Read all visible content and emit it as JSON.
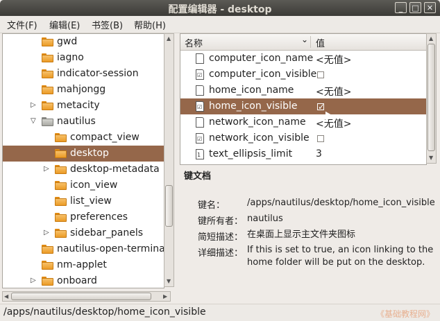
{
  "window": {
    "title": "配置编辑器 - desktop"
  },
  "window_buttons": {
    "minimize": "_",
    "maximize": "□",
    "close": "✕"
  },
  "menu": [
    "文件(F)",
    "编辑(E)",
    "书签(B)",
    "帮助(H)"
  ],
  "tree": {
    "items": [
      {
        "label": "gwd",
        "indent": 2,
        "expander": "",
        "selected": false,
        "gray": false
      },
      {
        "label": "iagno",
        "indent": 2,
        "expander": "",
        "selected": false,
        "gray": false
      },
      {
        "label": "indicator-session",
        "indent": 2,
        "expander": "",
        "selected": false,
        "gray": false
      },
      {
        "label": "mahjongg",
        "indent": 2,
        "expander": "",
        "selected": false,
        "gray": false
      },
      {
        "label": "metacity",
        "indent": 2,
        "expander": "collapsed",
        "selected": false,
        "gray": false
      },
      {
        "label": "nautilus",
        "indent": 2,
        "expander": "expanded",
        "selected": false,
        "gray": true
      },
      {
        "label": "compact_view",
        "indent": 3,
        "expander": "",
        "selected": false,
        "gray": false
      },
      {
        "label": "desktop",
        "indent": 3,
        "expander": "",
        "selected": true,
        "gray": false
      },
      {
        "label": "desktop-metadata",
        "indent": 3,
        "expander": "collapsed",
        "selected": false,
        "gray": false
      },
      {
        "label": "icon_view",
        "indent": 3,
        "expander": "",
        "selected": false,
        "gray": false
      },
      {
        "label": "list_view",
        "indent": 3,
        "expander": "",
        "selected": false,
        "gray": false
      },
      {
        "label": "preferences",
        "indent": 3,
        "expander": "",
        "selected": false,
        "gray": false
      },
      {
        "label": "sidebar_panels",
        "indent": 3,
        "expander": "collapsed",
        "selected": false,
        "gray": false
      },
      {
        "label": "nautilus-open-terminal",
        "indent": 2,
        "expander": "",
        "selected": false,
        "gray": false
      },
      {
        "label": "nm-applet",
        "indent": 2,
        "expander": "",
        "selected": false,
        "gray": false
      },
      {
        "label": "onboard",
        "indent": 2,
        "expander": "collapsed",
        "selected": false,
        "gray": false
      }
    ]
  },
  "list": {
    "headers": {
      "name": "名称",
      "value": "值"
    },
    "rows": [
      {
        "name": "computer_icon_name",
        "type": "text",
        "value": "<无值>",
        "selected": false
      },
      {
        "name": "computer_icon_visible",
        "type": "bool",
        "value": "",
        "checked": false,
        "selected": false
      },
      {
        "name": "home_icon_name",
        "type": "text",
        "value": "<无值>",
        "selected": false
      },
      {
        "name": "home_icon_visible",
        "type": "bool",
        "value": "",
        "checked": true,
        "selected": true
      },
      {
        "name": "network_icon_name",
        "type": "text",
        "value": "<无值>",
        "selected": false
      },
      {
        "name": "network_icon_visible",
        "type": "bool",
        "value": "",
        "checked": false,
        "selected": false
      },
      {
        "name": "text_ellipsis_limit",
        "type": "int",
        "value": "3",
        "selected": false
      }
    ]
  },
  "doc": {
    "title": "键文档",
    "fields": [
      {
        "label": "键名：",
        "value": "/apps/nautilus/desktop/home_icon_visible"
      },
      {
        "label": "键所有者：",
        "value": "nautilus"
      },
      {
        "label": "简短描述：",
        "value": "在桌面上显示主文件夹图标"
      },
      {
        "label": "详细描述：",
        "value": "If this is set to true, an icon linking to the home folder will be put on the desktop."
      }
    ]
  },
  "status": {
    "path": "/apps/nautilus/desktop/home_icon_visible",
    "watermark": "《基础教程网》"
  },
  "colors": {
    "selection": "#95674a",
    "titlebar": "#3c3b37",
    "folder": "#eb9b26"
  }
}
